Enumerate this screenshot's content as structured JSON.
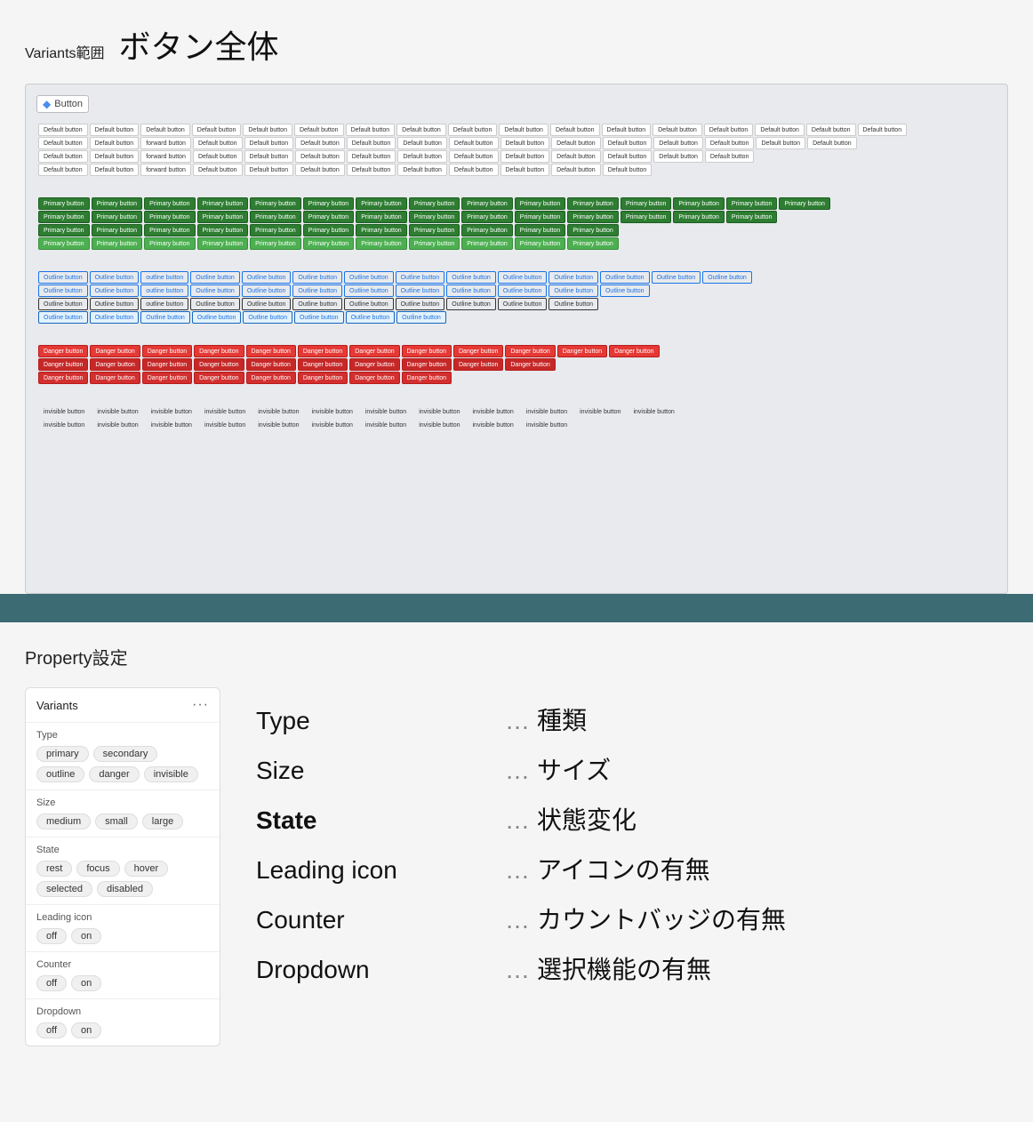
{
  "page": {
    "variants_label": "Variants範囲",
    "title": "ボタン全体"
  },
  "frame": {
    "label": "Button",
    "diamond": "◆"
  },
  "separator": {},
  "property_section": {
    "heading": "Property設定"
  },
  "variants_panel": {
    "title": "Variants",
    "menu_icon": "···",
    "sections": [
      {
        "name": "Type",
        "pills": [
          "primary",
          "secondary",
          "outline",
          "danger",
          "invisible"
        ]
      },
      {
        "name": "Size",
        "pills": [
          "medium",
          "small",
          "large"
        ]
      },
      {
        "name": "State",
        "pills": [
          "rest",
          "focus",
          "hover",
          "selected",
          "disabled"
        ]
      },
      {
        "name": "Leading icon",
        "pills": [
          "off",
          "on"
        ]
      },
      {
        "name": "Counter",
        "pills": [
          "off",
          "on"
        ]
      },
      {
        "name": "Dropdown",
        "pills": [
          "off",
          "on"
        ]
      }
    ]
  },
  "descriptions": [
    {
      "key": "Type",
      "dots": "…",
      "value": "種類",
      "bold": false
    },
    {
      "key": "Size",
      "dots": "…",
      "value": "サイズ",
      "bold": false
    },
    {
      "key": "State",
      "dots": "…",
      "value": "状態変化",
      "bold": true
    },
    {
      "key": "Leading icon",
      "dots": "…",
      "value": "アイコンの有無",
      "bold": false
    },
    {
      "key": "Counter",
      "dots": "…",
      "value": "カウントバッジの有無",
      "bold": false
    },
    {
      "key": "Dropdown",
      "dots": "…",
      "value": "選択機能の有無",
      "bold": false
    }
  ],
  "grid_buttons": {
    "default_label": "Default button",
    "primary_label": "Primary button",
    "outline_label": "Outline button",
    "danger_label": "Danger button",
    "invisible_label": "Invisible button"
  }
}
